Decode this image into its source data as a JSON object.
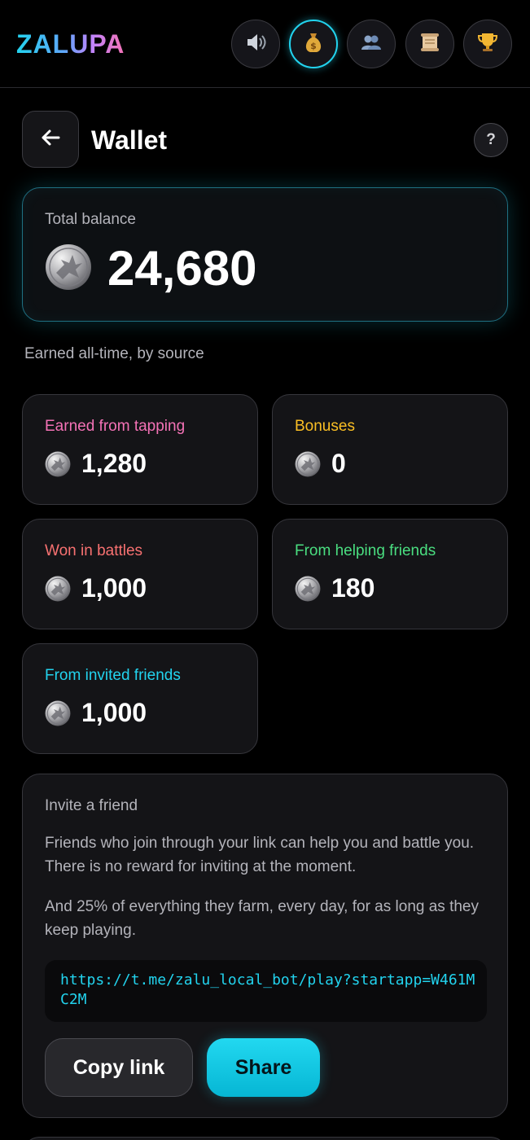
{
  "app": {
    "logo": "ZALUPA"
  },
  "nav": [
    {
      "icon": "speaker-icon",
      "glyph": "🔊",
      "active": false
    },
    {
      "icon": "money-bag-icon",
      "glyph": "💰",
      "active": true
    },
    {
      "icon": "friends-icon",
      "glyph": "👥",
      "active": false
    },
    {
      "icon": "scroll-icon",
      "glyph": "📜",
      "active": false
    },
    {
      "icon": "trophy-icon",
      "glyph": "🏆",
      "active": false
    }
  ],
  "header": {
    "title": "Wallet",
    "help": "?"
  },
  "balance": {
    "label": "Total balance",
    "value": "24,680"
  },
  "sources": {
    "label": "Earned all-time, by source",
    "items": [
      {
        "label": "Earned from tapping",
        "value": "1,280",
        "color": "#f472b6"
      },
      {
        "label": "Bonuses",
        "value": "0",
        "color": "#fbbf24"
      },
      {
        "label": "Won in battles",
        "value": "1,000",
        "color": "#f87171"
      },
      {
        "label": "From helping friends",
        "value": "180",
        "color": "#4ade80"
      },
      {
        "label": "From invited friends",
        "value": "1,000",
        "color": "#22d3ee"
      }
    ]
  },
  "invite": {
    "title": "Invite a friend",
    "p1": "Friends who join through your link can help you and battle you. There is no reward for inviting at the moment.",
    "p2": "And 25% of everything they farm, every day, for as long as they keep playing.",
    "link": "https://t.me/zalu_local_bot/play?startapp=W461MC2M",
    "copy_label": "Copy link",
    "share_label": "Share"
  },
  "colors": {
    "accent": "#22d3ee",
    "background": "#000000",
    "card": "#141417"
  }
}
